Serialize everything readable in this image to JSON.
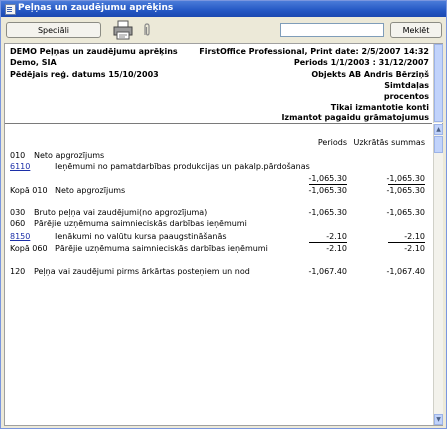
{
  "window": {
    "title": "Peļņas un zaudējumu aprēķins"
  },
  "toolbar": {
    "special_label": "Speciāli",
    "search_value": "",
    "search_label": "Meklēt",
    "printer_icon": "printer-icon",
    "attach_icon": "paperclip-icon"
  },
  "header": {
    "company_report": "DEMO Peļņas un zaudējumu aprēķins",
    "company_name": "Demo, SIA",
    "last_reg_date": "Pēdējais reģ. datums  15/10/2003",
    "print_info": "FirstOffice Professional, Print date: 2/5/2007 14:32",
    "periods": "Periods  1/1/2003 : 31/12/2007",
    "objects": "Objekts  AB  Andris Bērziņš",
    "opt1": "Simtdaļas",
    "opt2": "procentos",
    "opt3": "Tikai izmantotie konti",
    "opt4": "Izmantot pagaidu grāmatojumus"
  },
  "columns": {
    "period": "Periods",
    "accumulated": "Uzkrātās summas"
  },
  "rows": [
    {
      "code": "010",
      "text": "Neto apgrozījums",
      "period": "",
      "accum": ""
    },
    {
      "code": "6110",
      "text": "Ieņēmumi no pamatdarbības produkcijas un pakalp.pārdošanas",
      "period": "",
      "accum": ""
    },
    {
      "code": "",
      "text": "",
      "period": "-1,065.30",
      "accum": "-1,065.30"
    },
    {
      "code": "Kopā 010",
      "text": "Neto apgrozījums",
      "period": "-1,065.30",
      "accum": "-1,065.30"
    },
    {
      "code": "030",
      "text": "Bruto peļņa vai zaudējumi(no apgrozījuma)",
      "period": "-1,065.30",
      "accum": "-1,065.30"
    },
    {
      "code": "060",
      "text": "Pārējie uzņēmuma saimnieciskās darbības ieņēmumi",
      "period": "",
      "accum": ""
    },
    {
      "code": "8150",
      "text": "Ienākumi no valūtu kursa paaugstināšanās",
      "period": "-2.10",
      "accum": "-2.10"
    },
    {
      "code": "Kopā 060",
      "text": "Pārējie uzņēmuma saimnieciskās darbības ieņēmumi",
      "period": "-2.10",
      "accum": "-2.10"
    },
    {
      "code": "120",
      "text": "Peļņa vai zaudējumi pirms ārkārtas  posteņiem un nod",
      "period": "-1,067.40",
      "accum": "-1,067.40"
    }
  ],
  "colors": {
    "titlebar": "#2457c4",
    "link": "#1c2fa8"
  }
}
